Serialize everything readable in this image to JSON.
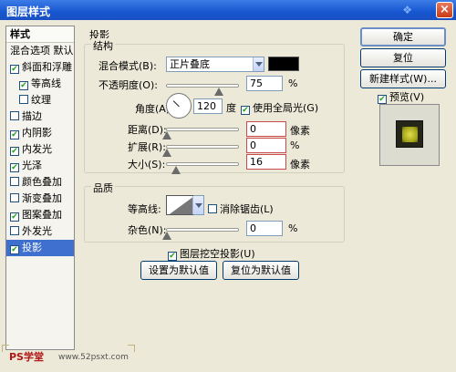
{
  "window": {
    "title": "图层样式",
    "close": "×"
  },
  "styles_panel": {
    "header": "样式",
    "blend_default": "混合选项 默认",
    "items": [
      {
        "label": "斜面和浮雕",
        "checked": true,
        "indent": false
      },
      {
        "label": "等高线",
        "checked": true,
        "indent": true
      },
      {
        "label": "纹理",
        "checked": false,
        "indent": true
      },
      {
        "label": "描边",
        "checked": false,
        "indent": false
      },
      {
        "label": "内阴影",
        "checked": true,
        "indent": false
      },
      {
        "label": "内发光",
        "checked": true,
        "indent": false
      },
      {
        "label": "光泽",
        "checked": true,
        "indent": false
      },
      {
        "label": "颜色叠加",
        "checked": false,
        "indent": false
      },
      {
        "label": "渐变叠加",
        "checked": false,
        "indent": false
      },
      {
        "label": "图案叠加",
        "checked": true,
        "indent": false
      },
      {
        "label": "外发光",
        "checked": false,
        "indent": false
      },
      {
        "label": "投影",
        "checked": true,
        "indent": false,
        "selected": true
      }
    ]
  },
  "section": "投影",
  "structure": {
    "title": "结构",
    "blend_mode_label": "混合模式(B):",
    "blend_mode_value": "正片叠底",
    "shadow_color": "#000000",
    "opacity_label": "不透明度(O):",
    "opacity_value": "75",
    "opacity_unit": "%",
    "angle_label": "角度(A):",
    "angle_value": "120",
    "angle_unit": "度",
    "global_light_label": "使用全局光(G)",
    "global_light_checked": true,
    "distance_label": "距离(D):",
    "distance_value": "0",
    "distance_unit": "像素",
    "spread_label": "扩展(R):",
    "spread_value": "0",
    "spread_unit": "%",
    "size_label": "大小(S):",
    "size_value": "16",
    "size_unit": "像素"
  },
  "quality": {
    "title": "品质",
    "contour_label": "等高线:",
    "antialias_label": "消除锯齿(L)",
    "antialias_checked": false,
    "noise_label": "杂色(N):",
    "noise_value": "0",
    "noise_unit": "%"
  },
  "knockout_label": "图层挖空投影(U)",
  "knockout_checked": true,
  "set_default_label": "设置为默认值",
  "reset_default_label": "复位为默认值",
  "buttons": {
    "ok": "确定",
    "reset": "复位",
    "new_style": "新建样式(W)...",
    "preview_label": "预览(V)",
    "preview_checked": true
  },
  "watermark": {
    "main": "PS学堂",
    "site": "www.52psxt.com"
  }
}
